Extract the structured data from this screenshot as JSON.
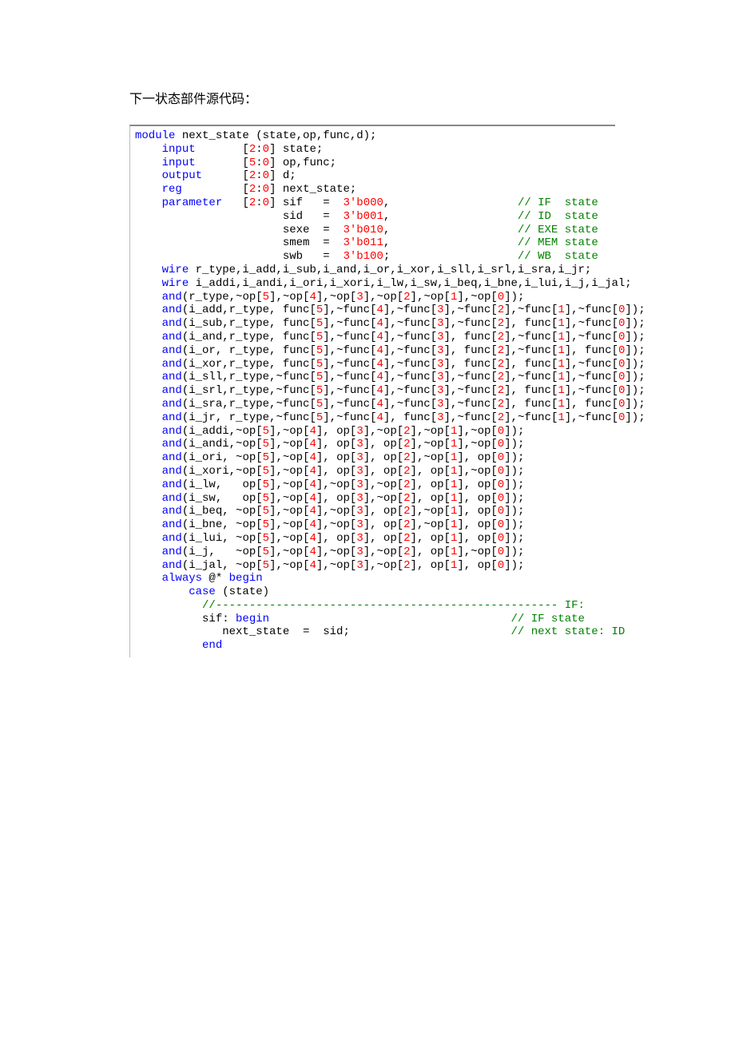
{
  "title": "下一状态部件源代码：",
  "code": {
    "l1a": "module",
    "l1b": " next_state (state,op,func,d);",
    "l2a": "    ",
    "l2b": "input",
    "l2c": "       [",
    "l2d": "2",
    "l2e": ":",
    "l2f": "0",
    "l2g": "] state;",
    "l3a": "    ",
    "l3b": "input",
    "l3c": "       [",
    "l3d": "5",
    "l3e": ":",
    "l3f": "0",
    "l3g": "] op,func;",
    "l4a": "    ",
    "l4b": "output",
    "l4c": "      [",
    "l4d": "2",
    "l4e": ":",
    "l4f": "0",
    "l4g": "] d;",
    "l5a": "    ",
    "l5b": "reg",
    "l5c": "         [",
    "l5d": "2",
    "l5e": ":",
    "l5f": "0",
    "l5g": "] next_state;",
    "l6a": "    ",
    "l6b": "parameter",
    "l6c": "   [",
    "l6d": "2",
    "l6e": ":",
    "l6f": "0",
    "l6g": "] sif   =  ",
    "l6h": "3'b000",
    "l6i": ",                   ",
    "l6j": "// IF  state",
    "l7a": "                      sid   =  ",
    "l7b": "3'b001",
    "l7c": ",                   ",
    "l7d": "// ID  state",
    "l8a": "                      sexe  =  ",
    "l8b": "3'b010",
    "l8c": ",                   ",
    "l8d": "// EXE state",
    "l9a": "                      smem  =  ",
    "l9b": "3'b011",
    "l9c": ",                   ",
    "l9d": "// MEM state",
    "l10a": "                      swb   =  ",
    "l10b": "3'b100",
    "l10c": ";                   ",
    "l10d": "// WB  state",
    "l11a": "    ",
    "l11b": "wire",
    "l11c": " r_type,i_add,i_sub,i_and,i_or,i_xor,i_sll,i_srl,i_sra,i_jr;",
    "l12a": "    ",
    "l12b": "wire",
    "l12c": " i_addi,i_andi,i_ori,i_xori,i_lw,i_sw,i_beq,i_bne,i_lui,i_j,i_jal;",
    "l13a": "    ",
    "l13b": "and",
    "l13c": "(r_type,~op[",
    "l13d": "5",
    "l13e": "],~op[",
    "l13f": "4",
    "l13g": "],~op[",
    "l13h": "3",
    "l13i": "],~op[",
    "l13j": "2",
    "l13k": "],~op[",
    "l13l": "1",
    "l13m": "],~op[",
    "l13n": "0",
    "l13o": "]);",
    "l14": "    and(i_add,r_type, func[5],~func[4],~func[3],~func[2],~func[1],~func[0]);",
    "l15": "    and(i_sub,r_type, func[5],~func[4],~func[3],~func[2], func[1],~func[0]);",
    "l16": "    and(i_and,r_type, func[5],~func[4],~func[3], func[2],~func[1],~func[0]);",
    "l17": "    and(i_or, r_type, func[5],~func[4],~func[3], func[2],~func[1], func[0]);",
    "l18": "    and(i_xor,r_type, func[5],~func[4],~func[3], func[2], func[1],~func[0]);",
    "l19": "    and(i_sll,r_type,~func[5],~func[4],~func[3],~func[2],~func[1],~func[0]);",
    "l20": "    and(i_srl,r_type,~func[5],~func[4],~func[3],~func[2], func[1],~func[0]);",
    "l21": "    and(i_sra,r_type,~func[5],~func[4],~func[3],~func[2], func[1], func[0]);",
    "l22": "    and(i_jr, r_type,~func[5],~func[4], func[3],~func[2],~func[1],~func[0]);",
    "l23": "    and(i_addi,~op[5],~op[4], op[3],~op[2],~op[1],~op[0]);",
    "l24": "    and(i_andi,~op[5],~op[4], op[3], op[2],~op[1],~op[0]);",
    "l25": "    and(i_ori, ~op[5],~op[4], op[3], op[2],~op[1], op[0]);",
    "l26": "    and(i_xori,~op[5],~op[4], op[3], op[2], op[1],~op[0]);",
    "l27": "    and(i_lw,   op[5],~op[4],~op[3],~op[2], op[1], op[0]);",
    "l28": "    and(i_sw,   op[5],~op[4], op[3],~op[2], op[1], op[0]);",
    "l29": "    and(i_beq, ~op[5],~op[4],~op[3], op[2],~op[1], op[0]);",
    "l30": "    and(i_bne, ~op[5],~op[4],~op[3], op[2],~op[1], op[0]);",
    "l31": "    and(i_lui, ~op[5],~op[4], op[3], op[2], op[1], op[0]);",
    "l32": "    and(i_j,   ~op[5],~op[4],~op[3],~op[2], op[1],~op[0]);",
    "l33": "    and(i_jal, ~op[5],~op[4],~op[3],~op[2], op[1], op[0]);",
    "l34a": "    ",
    "l34b": "always",
    "l34c": " @* ",
    "l34d": "begin",
    "l35a": "        ",
    "l35b": "case",
    "l35c": " (state)",
    "l36a": "          ",
    "l36b": "//--------------------------------------------------- IF:",
    "l37a": "          sif: ",
    "l37b": "begin",
    "l37c": "                                    ",
    "l37d": "// IF state",
    "l38a": "             next_state  =  sid;                        ",
    "l38b": "// next state: ID",
    "l39a": "          ",
    "l39b": "end"
  }
}
